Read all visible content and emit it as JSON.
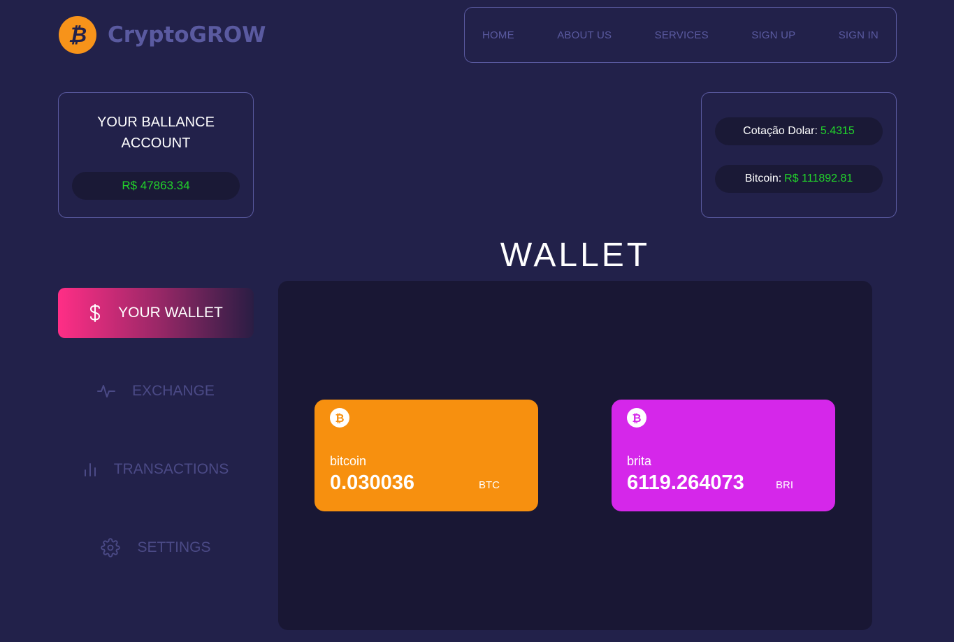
{
  "header": {
    "brand": "CryptoGROW",
    "nav": [
      "HOME",
      "ABOUT US",
      "SERVICES",
      "SIGN UP",
      "SIGN IN"
    ]
  },
  "balance": {
    "title": "YOUR BALLANCE ACCOUNT",
    "value": "R$ 47863.34"
  },
  "quotes": {
    "dollar_label": "Cotação Dolar:",
    "dollar_value": "5.4315",
    "bitcoin_label": "Bitcoin:",
    "bitcoin_value": "R$ 111892.81"
  },
  "sidebar": {
    "items": [
      {
        "label": "YOUR WALLET",
        "icon": "dollar-icon",
        "active": true
      },
      {
        "label": "EXCHANGE",
        "icon": "activity-icon",
        "active": false
      },
      {
        "label": "TRANSACTIONS",
        "icon": "bar-chart-icon",
        "active": false
      },
      {
        "label": "SETTINGS",
        "icon": "gear-icon",
        "active": false
      }
    ]
  },
  "wallet": {
    "title": "WALLET",
    "coins": [
      {
        "name": "bitcoin",
        "amount": "0.030036",
        "symbol": "BTC",
        "color": "#f7900f",
        "icon": "bitcoin-icon"
      },
      {
        "name": "brita",
        "amount": "6119.264073",
        "symbol": "BRI",
        "color": "#d527ea",
        "icon": "bitcoin-icon"
      }
    ]
  },
  "colors": {
    "background": "#22214a",
    "panel": "#191734",
    "accent_text": "#5a5aa0",
    "positive": "#22d32b",
    "brand_orange": "#f7931a",
    "active_gradient_start": "#ff2e86"
  }
}
